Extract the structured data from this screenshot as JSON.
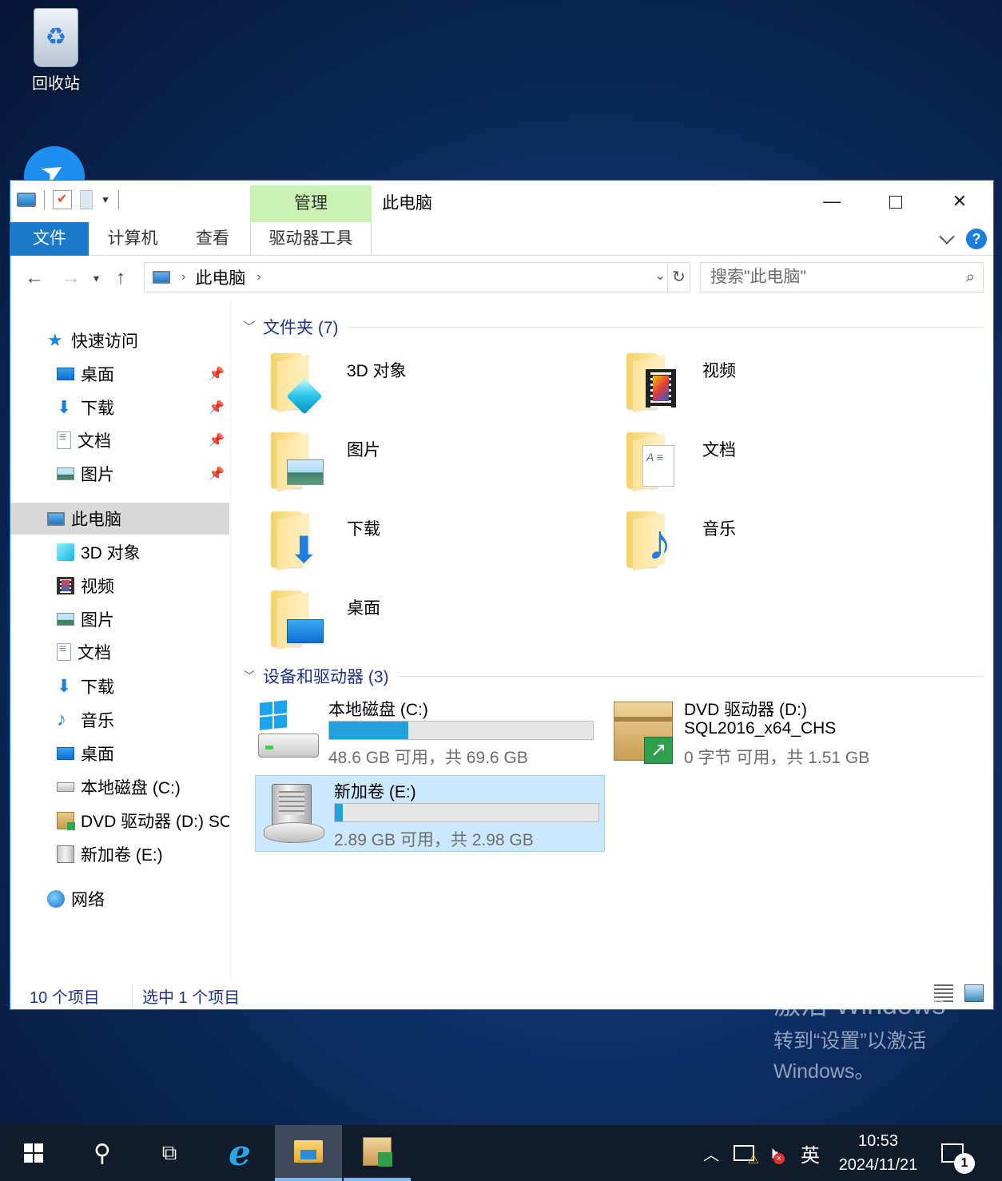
{
  "desktop": {
    "recycle_bin_label": "回收站"
  },
  "window": {
    "title": "此电脑",
    "contextual_tab_group": "管理",
    "ribbon_tabs": {
      "file": "文件",
      "computer": "计算机",
      "view": "查看",
      "drive_tools": "驱动器工具"
    },
    "controls": {
      "minimize": "—",
      "close": "✕"
    }
  },
  "navbar": {
    "breadcrumb": "此电脑",
    "search_placeholder": "搜索\"此电脑\""
  },
  "nav_pane": {
    "quick_access": "快速访问",
    "quick_items": [
      "桌面",
      "下载",
      "文档",
      "图片"
    ],
    "this_pc": "此电脑",
    "pc_items": [
      "3D 对象",
      "视频",
      "图片",
      "文档",
      "下载",
      "音乐",
      "桌面",
      "本地磁盘 (C:)",
      "DVD 驱动器 (D:) SC",
      "新加卷 (E:)"
    ],
    "network": "网络"
  },
  "content": {
    "folders_header": "文件夹 (7)",
    "folders": [
      "3D 对象",
      "视频",
      "图片",
      "文档",
      "下载",
      "音乐",
      "桌面"
    ],
    "drives_header": "设备和驱动器 (3)",
    "drives": [
      {
        "name": "本地磁盘 (C:)",
        "free_text": "48.6 GB 可用，共 69.6 GB",
        "used_fraction": 0.3
      },
      {
        "name": "DVD 驱动器 (D:)",
        "label": "SQL2016_x64_CHS",
        "free_text": "0 字节 可用，共 1.51 GB"
      },
      {
        "name": "新加卷 (E:)",
        "free_text": "2.89 GB 可用，共 2.98 GB",
        "used_fraction": 0.03
      }
    ]
  },
  "status": {
    "item_count": "10 个项目",
    "selected": "选中 1 个项目"
  },
  "activation": {
    "line1": "激活 Windows",
    "line2": "转到“设置”以激活",
    "line3": "Windows。"
  },
  "taskbar": {
    "ime": "英",
    "time": "10:53",
    "date": "2024/11/21",
    "notification_count": "1"
  },
  "colors": {
    "accent": "#1979ca",
    "contextual_tab": "#c9f1b2",
    "selection": "#cce8ff",
    "progress": "#26a0da"
  }
}
